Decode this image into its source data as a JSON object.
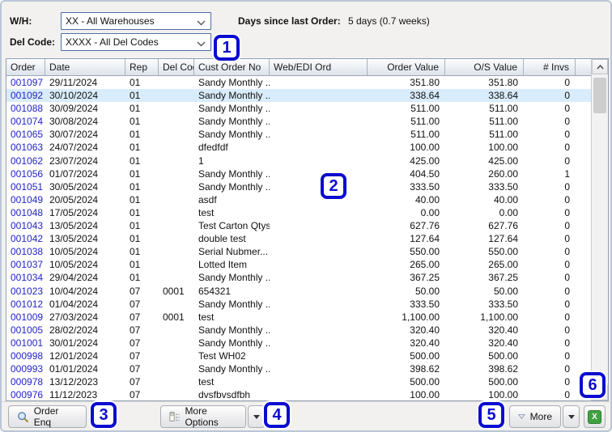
{
  "filters": {
    "wh_label": "W/H:",
    "wh_value": "XX - All Warehouses",
    "del_code_label": "Del Code:",
    "del_code_value": "XXXX - All Del Codes",
    "days_since_label": "Days since last Order:",
    "days_since_value": "5 days (0.7 weeks)"
  },
  "table": {
    "columns": [
      {
        "label": "Order"
      },
      {
        "label": "Date"
      },
      {
        "label": "Rep"
      },
      {
        "label": "Del Code"
      },
      {
        "label": "Cust Order No"
      },
      {
        "label": "Web/EDI Ord"
      },
      {
        "label": "Order Value"
      },
      {
        "label": "O/S Value"
      },
      {
        "label": "# Invs"
      }
    ],
    "rows": [
      {
        "order": "001097",
        "date": "29/11/2024",
        "rep": "01",
        "del_code": "",
        "cust_order_no": "Sandy Monthly ...",
        "web_edi": "",
        "order_value": "351.80",
        "os_value": "351.80",
        "invs": "0",
        "selected": false
      },
      {
        "order": "001092",
        "date": "30/10/2024",
        "rep": "01",
        "del_code": "",
        "cust_order_no": "Sandy Monthly ...",
        "web_edi": "",
        "order_value": "338.64",
        "os_value": "338.64",
        "invs": "0",
        "selected": true
      },
      {
        "order": "001088",
        "date": "30/09/2024",
        "rep": "01",
        "del_code": "",
        "cust_order_no": "Sandy Monthly ...",
        "web_edi": "",
        "order_value": "511.00",
        "os_value": "511.00",
        "invs": "0",
        "selected": false
      },
      {
        "order": "001074",
        "date": "30/08/2024",
        "rep": "01",
        "del_code": "",
        "cust_order_no": "Sandy Monthly ...",
        "web_edi": "",
        "order_value": "511.00",
        "os_value": "511.00",
        "invs": "0",
        "selected": false
      },
      {
        "order": "001065",
        "date": "30/07/2024",
        "rep": "01",
        "del_code": "",
        "cust_order_no": "Sandy Monthly ...",
        "web_edi": "",
        "order_value": "511.00",
        "os_value": "511.00",
        "invs": "0",
        "selected": false
      },
      {
        "order": "001063",
        "date": "24/07/2024",
        "rep": "01",
        "del_code": "",
        "cust_order_no": "dfedfdf",
        "web_edi": "",
        "order_value": "100.00",
        "os_value": "100.00",
        "invs": "0",
        "selected": false
      },
      {
        "order": "001062",
        "date": "23/07/2024",
        "rep": "01",
        "del_code": "",
        "cust_order_no": "1",
        "web_edi": "",
        "order_value": "425.00",
        "os_value": "425.00",
        "invs": "0",
        "selected": false
      },
      {
        "order": "001056",
        "date": "01/07/2024",
        "rep": "01",
        "del_code": "",
        "cust_order_no": "Sandy Monthly ...",
        "web_edi": "",
        "order_value": "404.50",
        "os_value": "260.00",
        "invs": "1",
        "selected": false
      },
      {
        "order": "001051",
        "date": "30/05/2024",
        "rep": "01",
        "del_code": "",
        "cust_order_no": "Sandy Monthly ...",
        "web_edi": "",
        "order_value": "333.50",
        "os_value": "333.50",
        "invs": "0",
        "selected": false
      },
      {
        "order": "001049",
        "date": "20/05/2024",
        "rep": "01",
        "del_code": "",
        "cust_order_no": "asdf",
        "web_edi": "",
        "order_value": "40.00",
        "os_value": "40.00",
        "invs": "0",
        "selected": false
      },
      {
        "order": "001048",
        "date": "17/05/2024",
        "rep": "01",
        "del_code": "",
        "cust_order_no": "test",
        "web_edi": "",
        "order_value": "0.00",
        "os_value": "0.00",
        "invs": "0",
        "selected": false
      },
      {
        "order": "001043",
        "date": "13/05/2024",
        "rep": "01",
        "del_code": "",
        "cust_order_no": "Test Carton Qtys",
        "web_edi": "",
        "order_value": "627.76",
        "os_value": "627.76",
        "invs": "0",
        "selected": false
      },
      {
        "order": "001042",
        "date": "13/05/2024",
        "rep": "01",
        "del_code": "",
        "cust_order_no": "double test",
        "web_edi": "",
        "order_value": "127.64",
        "os_value": "127.64",
        "invs": "0",
        "selected": false
      },
      {
        "order": "001038",
        "date": "10/05/2024",
        "rep": "01",
        "del_code": "",
        "cust_order_no": "Serial Nubmer...",
        "web_edi": "",
        "order_value": "550.00",
        "os_value": "550.00",
        "invs": "0",
        "selected": false
      },
      {
        "order": "001037",
        "date": "10/05/2024",
        "rep": "01",
        "del_code": "",
        "cust_order_no": "Lotted Item",
        "web_edi": "",
        "order_value": "265.00",
        "os_value": "265.00",
        "invs": "0",
        "selected": false
      },
      {
        "order": "001034",
        "date": "29/04/2024",
        "rep": "01",
        "del_code": "",
        "cust_order_no": "Sandy Monthly ...",
        "web_edi": "",
        "order_value": "367.25",
        "os_value": "367.25",
        "invs": "0",
        "selected": false
      },
      {
        "order": "001023",
        "date": "10/04/2024",
        "rep": "07",
        "del_code": "0001",
        "cust_order_no": "654321",
        "web_edi": "",
        "order_value": "50.00",
        "os_value": "50.00",
        "invs": "0",
        "selected": false
      },
      {
        "order": "001012",
        "date": "01/04/2024",
        "rep": "07",
        "del_code": "",
        "cust_order_no": "Sandy Monthly ...",
        "web_edi": "",
        "order_value": "333.50",
        "os_value": "333.50",
        "invs": "0",
        "selected": false
      },
      {
        "order": "001009",
        "date": "27/03/2024",
        "rep": "07",
        "del_code": "0001",
        "cust_order_no": "test",
        "web_edi": "",
        "order_value": "1,100.00",
        "os_value": "1,100.00",
        "invs": "0",
        "selected": false
      },
      {
        "order": "001005",
        "date": "28/02/2024",
        "rep": "07",
        "del_code": "",
        "cust_order_no": "Sandy Monthly ...",
        "web_edi": "",
        "order_value": "320.40",
        "os_value": "320.40",
        "invs": "0",
        "selected": false
      },
      {
        "order": "001001",
        "date": "30/01/2024",
        "rep": "07",
        "del_code": "",
        "cust_order_no": "Sandy Monthly ...",
        "web_edi": "",
        "order_value": "320.40",
        "os_value": "320.40",
        "invs": "0",
        "selected": false
      },
      {
        "order": "000998",
        "date": "12/01/2024",
        "rep": "07",
        "del_code": "",
        "cust_order_no": "Test WH02",
        "web_edi": "",
        "order_value": "500.00",
        "os_value": "500.00",
        "invs": "0",
        "selected": false
      },
      {
        "order": "000993",
        "date": "01/01/2024",
        "rep": "07",
        "del_code": "",
        "cust_order_no": "Sandy Monthly ...",
        "web_edi": "",
        "order_value": "398.62",
        "os_value": "398.62",
        "invs": "0",
        "selected": false
      },
      {
        "order": "000978",
        "date": "13/12/2023",
        "rep": "07",
        "del_code": "",
        "cust_order_no": "test",
        "web_edi": "",
        "order_value": "500.00",
        "os_value": "500.00",
        "invs": "0",
        "selected": false
      },
      {
        "order": "000976",
        "date": "11/12/2023",
        "rep": "07",
        "del_code": "",
        "cust_order_no": "dvsfbvsdfbh",
        "web_edi": "",
        "order_value": "100.00",
        "os_value": "100.00",
        "invs": "0",
        "selected": false
      }
    ]
  },
  "toolbar": {
    "order_enq_label": "Order Enq",
    "more_options_label": "More Options",
    "more_label": "More",
    "excel_icon_glyph": "X"
  },
  "annotations": [
    {
      "label": "1"
    },
    {
      "label": "2"
    },
    {
      "label": "3"
    },
    {
      "label": "4"
    },
    {
      "label": "5"
    },
    {
      "label": "6"
    }
  ],
  "colors": {
    "order_link_blue": "#2323c8",
    "selected_row_bg": "#d9ecfb",
    "annotation_blue": "#0b0bd0",
    "excel_green": "#3fa23f",
    "combo_border_blue": "#4d6fa8",
    "header_border": "#98a4b4"
  }
}
